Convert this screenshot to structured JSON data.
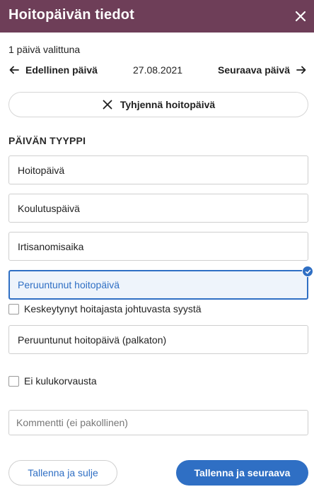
{
  "header": {
    "title": "Hoitopäivän tiedot",
    "close_icon": "close-icon"
  },
  "selection": {
    "count_text": "1 päivä valittuna"
  },
  "nav": {
    "prev_label": "Edellinen päivä",
    "date": "27.08.2021",
    "next_label": "Seuraava päivä"
  },
  "clear_button": {
    "label": "Tyhjennä hoitopäivä",
    "icon": "close-icon"
  },
  "day_type": {
    "title": "PÄIVÄN TYYPPI",
    "options": [
      {
        "label": "Hoitopäivä",
        "selected": false
      },
      {
        "label": "Koulutuspäivä",
        "selected": false
      },
      {
        "label": "Irtisanomisaika",
        "selected": false
      },
      {
        "label": "Peruuntunut hoitopäivä",
        "selected": true
      },
      {
        "label": "Peruuntunut hoitopäivä (palkaton)",
        "selected": false
      }
    ],
    "interruption_checkbox": {
      "label": "Keskeytynyt hoitajasta johtuvasta syystä",
      "checked": false
    }
  },
  "no_compensation_checkbox": {
    "label": "Ei kulukorvausta",
    "checked": false
  },
  "comment": {
    "placeholder": "Kommentti (ei pakollinen)",
    "value": ""
  },
  "actions": {
    "save_close_label": "Tallenna ja sulje",
    "save_next_label": "Tallenna ja seuraava"
  },
  "colors": {
    "header_bg": "#6e3e58",
    "accent": "#2f6fc4",
    "selected_bg": "#eef4fb"
  }
}
